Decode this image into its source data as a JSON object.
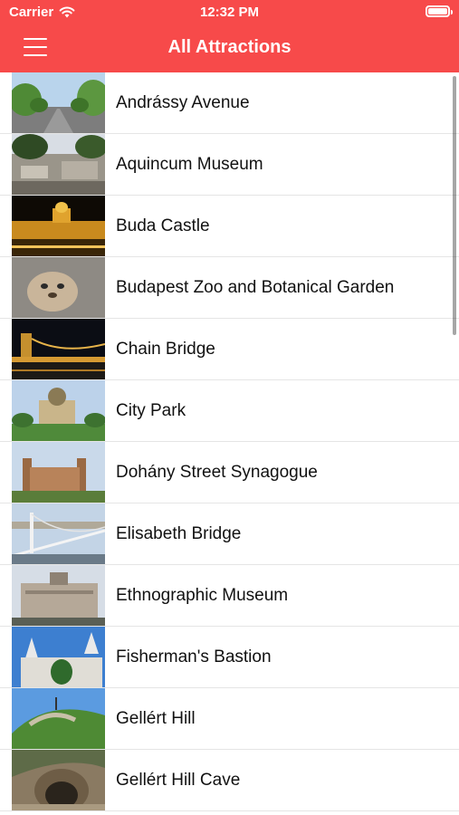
{
  "status_bar": {
    "carrier": "Carrier",
    "time": "12:32 PM"
  },
  "nav": {
    "title": "All Attractions",
    "menu_icon": "hamburger-menu-icon"
  },
  "attractions": [
    {
      "name": "Andrássy Avenue",
      "thumbnail": "tree-lined avenue photo"
    },
    {
      "name": "Aquincum Museum",
      "thumbnail": "roman ruins photo"
    },
    {
      "name": "Buda Castle",
      "thumbnail": "illuminated castle at night photo"
    },
    {
      "name": "Budapest Zoo and Botanical Garden",
      "thumbnail": "prairie dog photo"
    },
    {
      "name": "Chain Bridge",
      "thumbnail": "lit bridge at night photo"
    },
    {
      "name": "City Park",
      "thumbnail": "domed building in park photo"
    },
    {
      "name": "Dohány Street Synagogue",
      "thumbnail": "synagogue with twin towers photo"
    },
    {
      "name": "Elisabeth Bridge",
      "thumbnail": "white suspension bridge photo"
    },
    {
      "name": "Ethnographic Museum",
      "thumbnail": "grand museum facade photo"
    },
    {
      "name": "Fisherman's Bastion",
      "thumbnail": "white turrets photo"
    },
    {
      "name": "Gellért Hill",
      "thumbnail": "green hill photo"
    },
    {
      "name": "Gellért Hill Cave",
      "thumbnail": "cave entrance photo"
    }
  ],
  "colors": {
    "header": "#f74a4a",
    "text": "#111111",
    "separator": "#e5e5e5"
  }
}
